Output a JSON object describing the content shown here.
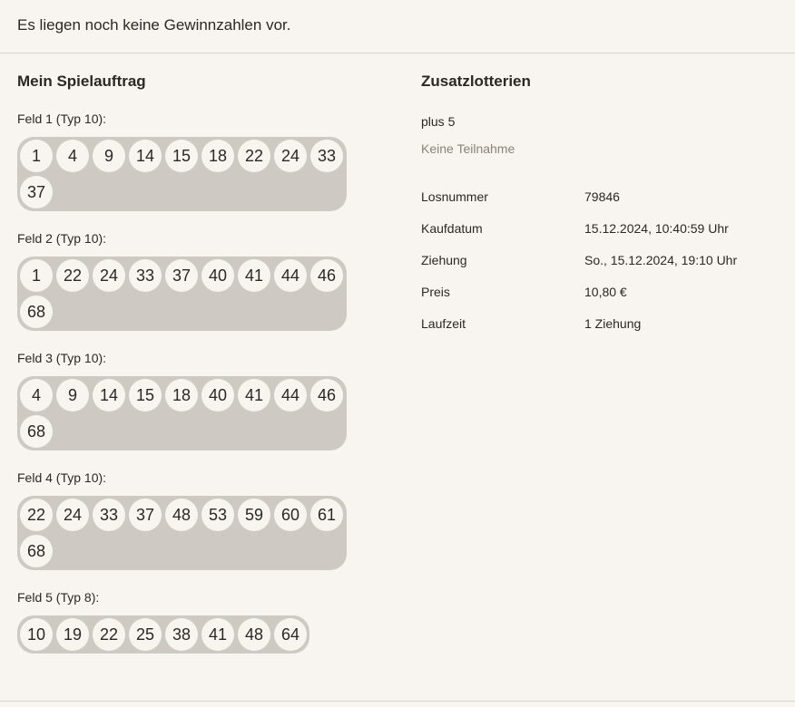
{
  "notice": "Es liegen noch keine Gewinnzahlen vor.",
  "left": {
    "title": "Mein Spielauftrag",
    "fields": [
      {
        "label": "Feld 1 (Typ 10):",
        "numbers": [
          "1",
          "4",
          "9",
          "14",
          "15",
          "18",
          "22",
          "24",
          "33",
          "37"
        ]
      },
      {
        "label": "Feld 2 (Typ 10):",
        "numbers": [
          "1",
          "22",
          "24",
          "33",
          "37",
          "40",
          "41",
          "44",
          "46",
          "68"
        ]
      },
      {
        "label": "Feld 3 (Typ 10):",
        "numbers": [
          "4",
          "9",
          "14",
          "15",
          "18",
          "40",
          "41",
          "44",
          "46",
          "68"
        ]
      },
      {
        "label": "Feld 4 (Typ 10):",
        "numbers": [
          "22",
          "24",
          "33",
          "37",
          "48",
          "53",
          "59",
          "60",
          "61",
          "68"
        ]
      },
      {
        "label": "Feld 5 (Typ 8):",
        "numbers": [
          "10",
          "19",
          "22",
          "25",
          "38",
          "41",
          "48",
          "64"
        ]
      }
    ]
  },
  "right": {
    "title": "Zusatzlotterien",
    "lottery_name": "plus 5",
    "lottery_status": "Keine Teilnahme",
    "info": [
      {
        "key": "Losnummer",
        "value": "79846"
      },
      {
        "key": "Kaufdatum",
        "value": "15.12.2024, 10:40:59 Uhr"
      },
      {
        "key": "Ziehung",
        "value": "So., 15.12.2024, 19:10 Uhr"
      },
      {
        "key": "Preis",
        "value": "10,80 €"
      },
      {
        "key": "Laufzeit",
        "value": "1 Ziehung"
      }
    ]
  },
  "colors": {
    "background": "#f8f5f0",
    "ball_box": "#cfc9c3",
    "ball": "#f8f5f0",
    "text": "#2c2723",
    "muted": "#8a827b"
  }
}
